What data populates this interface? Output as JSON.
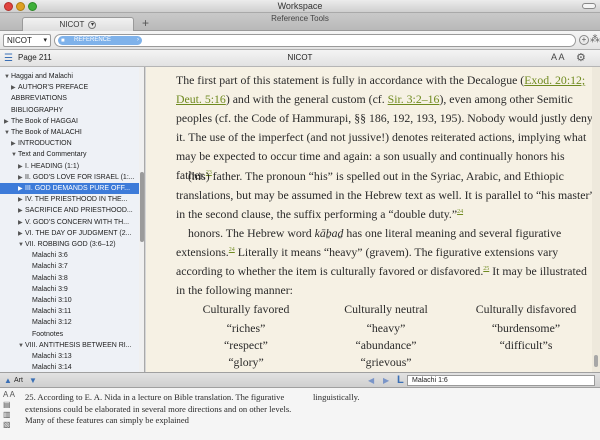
{
  "window": {
    "title": "Workspace"
  },
  "tabs": {
    "group_label": "Reference Tools",
    "items": [
      {
        "label": "NICOT"
      }
    ],
    "add_label": "+"
  },
  "address": {
    "resource": "NICOT",
    "reference_chip": "REFERENCE"
  },
  "panel": {
    "page": "Page 211",
    "title": "NICOT",
    "font_size_label": "A A"
  },
  "toc": [
    {
      "label": "Haggai and Malachi",
      "indent": 0,
      "expander": "open"
    },
    {
      "label": "AUTHOR'S PREFACE",
      "indent": 1,
      "expander": "closed"
    },
    {
      "label": "ABBREVIATIONS",
      "indent": 0,
      "expander": "none"
    },
    {
      "label": "BIBLIOGRAPHY",
      "indent": 0,
      "expander": "none"
    },
    {
      "label": "The Book of HAGGAI",
      "indent": 0,
      "expander": "closed"
    },
    {
      "label": "The Book of MALACHI",
      "indent": 0,
      "expander": "open"
    },
    {
      "label": "INTRODUCTION",
      "indent": 1,
      "expander": "closed"
    },
    {
      "label": "Text and Commentary",
      "indent": 1,
      "expander": "open"
    },
    {
      "label": "I. HEADING (1:1)",
      "indent": 2,
      "expander": "closed"
    },
    {
      "label": "II. GOD'S LOVE FOR ISRAEL (1:...",
      "indent": 2,
      "expander": "closed"
    },
    {
      "label": "III. GOD DEMANDS PURE OFF...",
      "indent": 2,
      "expander": "closed",
      "selected": true
    },
    {
      "label": "IV. THE PRIESTHOOD IN THE...",
      "indent": 2,
      "expander": "closed"
    },
    {
      "label": "SACRIFICE AND PRIESTHOOD...",
      "indent": 2,
      "expander": "closed"
    },
    {
      "label": "V. GOD'S CONCERN WITH TH...",
      "indent": 2,
      "expander": "closed"
    },
    {
      "label": "VI. THE DAY OF JUDGMENT (2...",
      "indent": 2,
      "expander": "closed"
    },
    {
      "label": "VII. ROBBING GOD (3:6–12)",
      "indent": 2,
      "expander": "open"
    },
    {
      "label": "Malachi 3:6",
      "indent": 3,
      "expander": "none"
    },
    {
      "label": "Malachi 3:7",
      "indent": 3,
      "expander": "none"
    },
    {
      "label": "Malachi 3:8",
      "indent": 3,
      "expander": "none"
    },
    {
      "label": "Malachi 3:9",
      "indent": 3,
      "expander": "none"
    },
    {
      "label": "Malachi 3:10",
      "indent": 3,
      "expander": "none"
    },
    {
      "label": "Malachi 3:11",
      "indent": 3,
      "expander": "none"
    },
    {
      "label": "Malachi 3:12",
      "indent": 3,
      "expander": "none"
    },
    {
      "label": "Footnotes",
      "indent": 3,
      "expander": "none"
    },
    {
      "label": "VIII. ANTITHESIS BETWEEN RI...",
      "indent": 2,
      "expander": "open"
    },
    {
      "label": "Malachi 3:13",
      "indent": 3,
      "expander": "none"
    },
    {
      "label": "Malachi 3:14",
      "indent": 3,
      "expander": "none"
    }
  ],
  "reading": {
    "p1": {
      "a": "The first part of this statement is fully in accordance with the Decalogue (",
      "link1": "Exod. 20:12;",
      "link2": "Deut. 5:16",
      "b": ") and with the general custom (cf. ",
      "link3": "Sir. 3:2–16",
      "c": "), even among other Semitic peoples (cf. the Code of Hammurapi, §§ 186, 192, 193, 195). Nobody would justly deny it. The use of the imperfect (and not jussive!) denotes reiterated actions, implying what may be expected to occur time and again: a son usually and continually honors his father.",
      "fn": "23"
    },
    "p2": {
      "a": "(his) father. The pronoun “his” is spelled out in the Syriac, Arabic, and Ethiopic translations, but may be assumed in the Hebrew text as well. It is parallel to “his master” in the second clause, the suffix performing a “double duty.”",
      "fn": "24"
    },
    "p3": {
      "a": "honors. The Hebrew word ",
      "translit": "kāḇaḏ",
      "b": " has one literal meaning and several figurative extensions.",
      "fn1": "24",
      "c": " Literally it means “heavy” (gravem). The figurative extensions vary according to whether the item is culturally favored or disfavored.",
      "fn2": "25",
      "d": " It may be illustrated in the following manner:"
    },
    "table": {
      "headers": [
        "Culturally favored",
        "Culturally neutral",
        "Culturally disfavored"
      ],
      "rows": [
        [
          "“riches”",
          "“heavy”",
          "“burdensome”"
        ],
        [
          "“respect”",
          "“abundance”",
          "“difficult”s"
        ],
        [
          "“glory”",
          "“grievous”",
          ""
        ]
      ]
    }
  },
  "bottom": {
    "art_label": "Art",
    "verse": "Malachi  1:6"
  },
  "footnote": {
    "col1": "25. According to E. A. Nida in a lecture on Bible translation. The figurative extensions could be elaborated in several more directions and on other levels. Many of these features can simply be explained",
    "col2": "linguistically."
  }
}
